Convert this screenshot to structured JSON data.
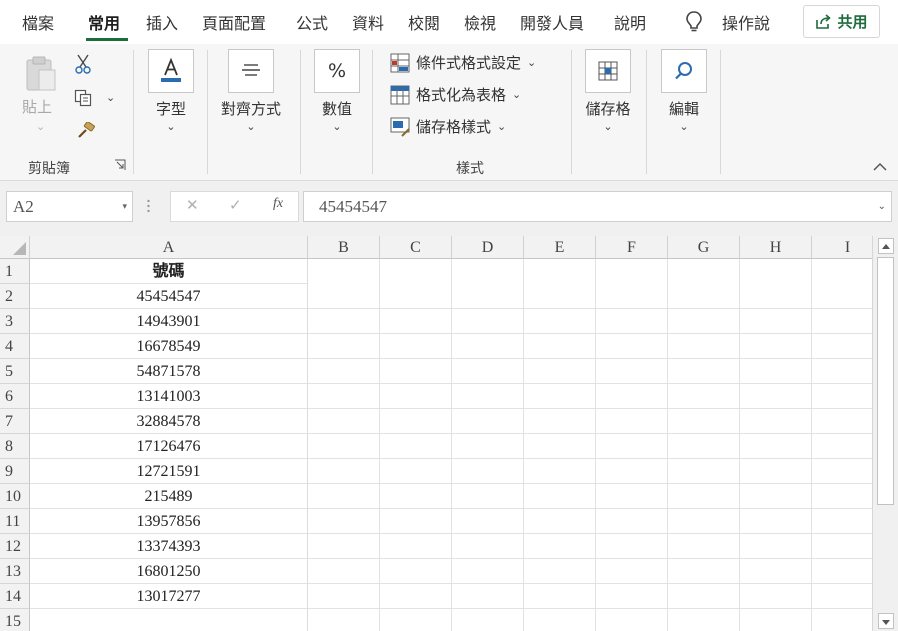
{
  "menu": {
    "tabs": [
      "檔案",
      "常用",
      "插入",
      "頁面配置",
      "公式",
      "資料",
      "校閱",
      "檢視",
      "開發人員",
      "說明"
    ],
    "active_tab": "常用",
    "tell_me": "操作說",
    "share": "共用"
  },
  "ribbon": {
    "clipboard": {
      "paste": "貼上",
      "group_label": "剪貼簿"
    },
    "font": {
      "label": "字型"
    },
    "alignment": {
      "label": "對齊方式"
    },
    "number": {
      "label": "數值"
    },
    "styles": {
      "conditional_formatting": "條件式格式設定",
      "format_as_table": "格式化為表格",
      "cell_styles": "儲存格樣式",
      "group_label": "樣式"
    },
    "cells": {
      "label": "儲存格"
    },
    "editing": {
      "label": "編輯"
    }
  },
  "formula_bar": {
    "name_box": "A2",
    "fx": "fx",
    "content": "45454547"
  },
  "grid": {
    "columns": [
      "A",
      "B",
      "C",
      "D",
      "E",
      "F",
      "G",
      "H",
      "I"
    ],
    "rows": [
      "1",
      "2",
      "3",
      "4",
      "5",
      "6",
      "7",
      "8",
      "9",
      "10",
      "11",
      "12",
      "13",
      "14",
      "15"
    ],
    "column_a": [
      "號碼",
      "45454547",
      "14943901",
      "16678549",
      "54871578",
      "13141003",
      "32884578",
      "17126476",
      "12721591",
      "215489",
      "13957856",
      "13374393",
      "16801250",
      "13017277",
      ""
    ]
  },
  "colors": {
    "accent": "#1e6b3c",
    "ribbon_bg": "#f6f6f6",
    "header_bg": "#f2f2f2",
    "gridline": "#e2e2e2"
  }
}
